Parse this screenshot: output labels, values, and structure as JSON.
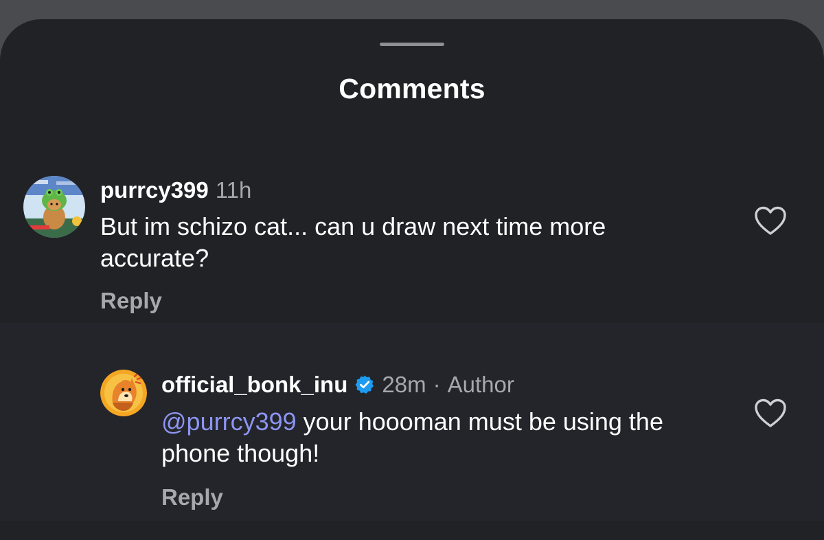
{
  "sheet": {
    "title": "Comments"
  },
  "comments": [
    {
      "username": "purrcy399",
      "time": "11h",
      "text": "But im schizo cat... can u draw next time more accurate?",
      "reply_label": "Reply",
      "avatar_icon": "cat-in-frog-hat-avatar",
      "like_icon": "heart-outline-icon"
    }
  ],
  "replies": [
    {
      "username": "official_bonk_inu",
      "verified": true,
      "verified_icon": "verified-badge-icon",
      "verified_color": "#1d9bf0",
      "time": "28m",
      "separator": "·",
      "author_tag": "Author",
      "mention": "@purrcy399",
      "text": "your hoooman must be using the phone though!",
      "reply_label": "Reply",
      "avatar_icon": "shiba-dog-logo-avatar",
      "like_icon": "heart-outline-icon"
    }
  ],
  "colors": {
    "background": "#212226",
    "text": "#ffffff",
    "muted": "#a6a8ad",
    "mention": "#8c95f2"
  }
}
